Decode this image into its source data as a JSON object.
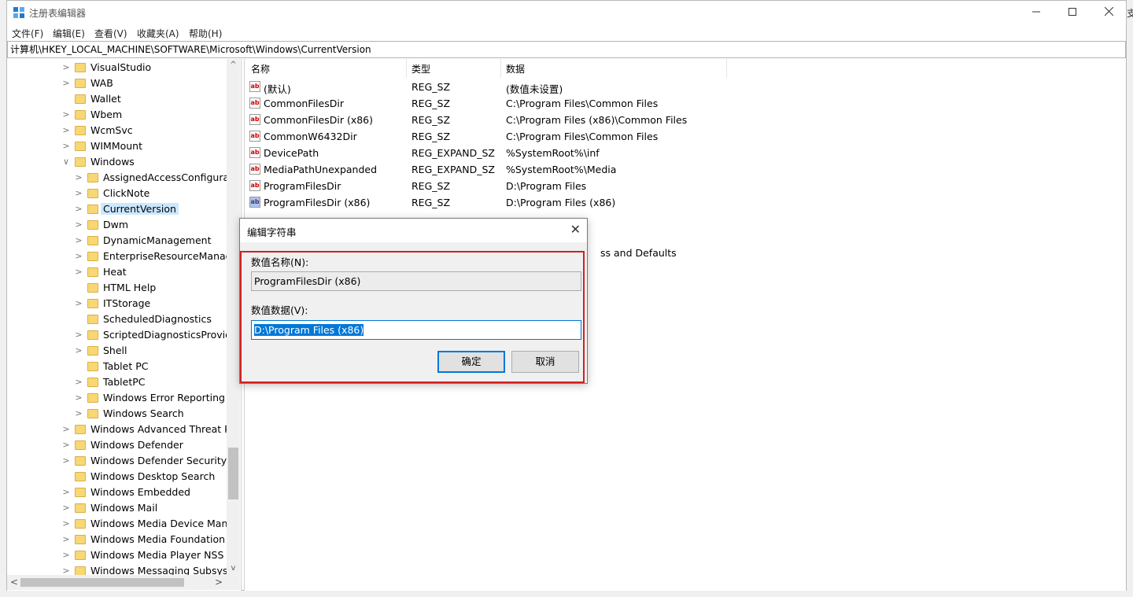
{
  "window": {
    "title": "注册表编辑器",
    "address_path": "计算机\\HKEY_LOCAL_MACHINE\\SOFTWARE\\Microsoft\\Windows\\CurrentVersion"
  },
  "menu": [
    {
      "label": "文件(F)"
    },
    {
      "label": "编辑(E)"
    },
    {
      "label": "查看(V)"
    },
    {
      "label": "收藏夹(A)"
    },
    {
      "label": "帮助(H)"
    }
  ],
  "tree": [
    {
      "label": "VisualStudio",
      "level": 1,
      "has_children": true
    },
    {
      "label": "WAB",
      "level": 1,
      "has_children": true
    },
    {
      "label": "Wallet",
      "level": 1,
      "has_children": false
    },
    {
      "label": "Wbem",
      "level": 1,
      "has_children": true
    },
    {
      "label": "WcmSvc",
      "level": 1,
      "has_children": true
    },
    {
      "label": "WIMMount",
      "level": 1,
      "has_children": true
    },
    {
      "label": "Windows",
      "level": 1,
      "has_children": true,
      "expanded": true
    },
    {
      "label": "AssignedAccessConfigurati",
      "level": 2,
      "has_children": true
    },
    {
      "label": "ClickNote",
      "level": 2,
      "has_children": true
    },
    {
      "label": "CurrentVersion",
      "level": 2,
      "has_children": true,
      "selected": true
    },
    {
      "label": "Dwm",
      "level": 2,
      "has_children": true
    },
    {
      "label": "DynamicManagement",
      "level": 2,
      "has_children": true
    },
    {
      "label": "EnterpriseResourceManage",
      "level": 2,
      "has_children": true
    },
    {
      "label": "Heat",
      "level": 2,
      "has_children": true
    },
    {
      "label": "HTML Help",
      "level": 2,
      "has_children": false
    },
    {
      "label": "ITStorage",
      "level": 2,
      "has_children": true
    },
    {
      "label": "ScheduledDiagnostics",
      "level": 2,
      "has_children": false
    },
    {
      "label": "ScriptedDiagnosticsProvide",
      "level": 2,
      "has_children": true
    },
    {
      "label": "Shell",
      "level": 2,
      "has_children": true
    },
    {
      "label": "Tablet PC",
      "level": 2,
      "has_children": false
    },
    {
      "label": "TabletPC",
      "level": 2,
      "has_children": true
    },
    {
      "label": "Windows Error Reporting",
      "level": 2,
      "has_children": true
    },
    {
      "label": "Windows Search",
      "level": 2,
      "has_children": true
    },
    {
      "label": "Windows Advanced Threat Pr",
      "level": 1,
      "has_children": true
    },
    {
      "label": "Windows Defender",
      "level": 1,
      "has_children": true
    },
    {
      "label": "Windows Defender Security C",
      "level": 1,
      "has_children": true
    },
    {
      "label": "Windows Desktop Search",
      "level": 1,
      "has_children": false
    },
    {
      "label": "Windows Embedded",
      "level": 1,
      "has_children": true
    },
    {
      "label": "Windows Mail",
      "level": 1,
      "has_children": true
    },
    {
      "label": "Windows Media Device Mana",
      "level": 1,
      "has_children": true
    },
    {
      "label": "Windows Media Foundation",
      "level": 1,
      "has_children": true
    },
    {
      "label": "Windows Media Player NSS",
      "level": 1,
      "has_children": true
    },
    {
      "label": "Windows Messaging Subsyste",
      "level": 1,
      "has_children": true
    }
  ],
  "columns": {
    "name": "名称",
    "type": "类型",
    "data": "数据"
  },
  "values": [
    {
      "name": "(默认)",
      "type": "REG_SZ",
      "data": "(数值未设置)"
    },
    {
      "name": "CommonFilesDir",
      "type": "REG_SZ",
      "data": "C:\\Program Files\\Common Files"
    },
    {
      "name": "CommonFilesDir (x86)",
      "type": "REG_SZ",
      "data": "C:\\Program Files (x86)\\Common Files"
    },
    {
      "name": "CommonW6432Dir",
      "type": "REG_SZ",
      "data": "C:\\Program Files\\Common Files"
    },
    {
      "name": "DevicePath",
      "type": "REG_EXPAND_SZ",
      "data": "%SystemRoot%\\inf"
    },
    {
      "name": "MediaPathUnexpanded",
      "type": "REG_EXPAND_SZ",
      "data": "%SystemRoot%\\Media"
    },
    {
      "name": "ProgramFilesDir",
      "type": "REG_SZ",
      "data": "D:\\Program Files"
    },
    {
      "name": "ProgramFilesDir (x86)",
      "type": "REG_SZ",
      "data": "D:\\Program Files (x86)",
      "selected": true
    }
  ],
  "partial_text": "ss and Defaults",
  "dialog": {
    "title": "编辑字符串",
    "name_label": "数值名称(N):",
    "name_value": "ProgramFilesDir (x86)",
    "data_label": "数值数据(V):",
    "data_value": "D:\\Program Files (x86)",
    "ok_label": "确定",
    "cancel_label": "取消"
  },
  "icons": {
    "value_icon_text": "ab"
  },
  "colors": {
    "highlight_border": "#d32020",
    "selection": "#0078d7"
  }
}
